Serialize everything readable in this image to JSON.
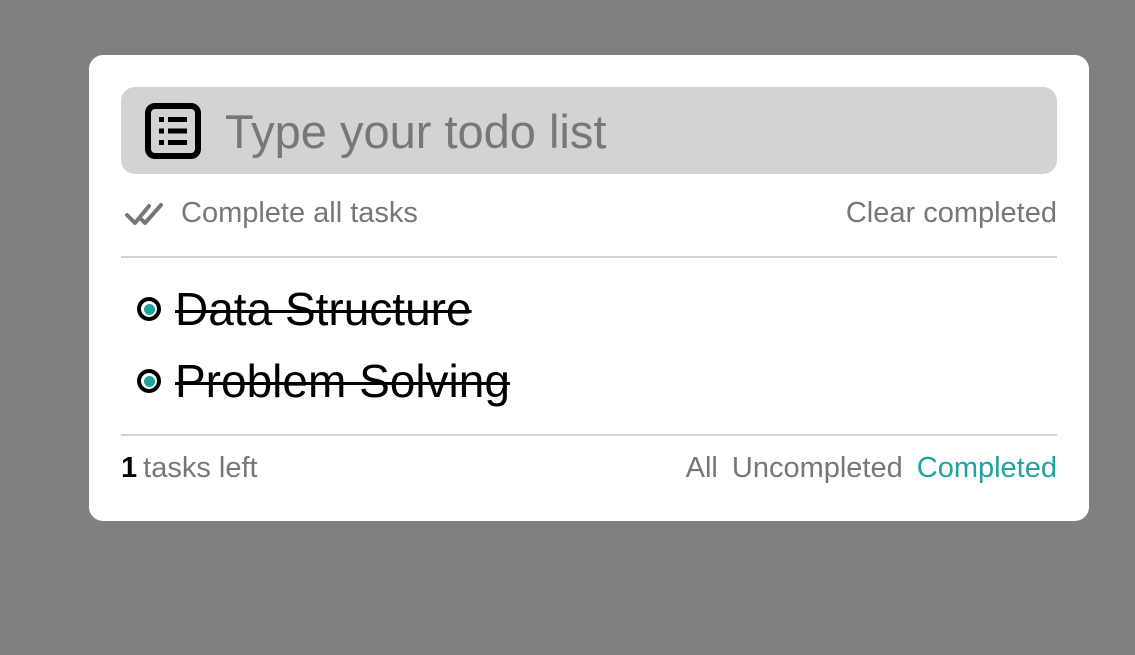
{
  "input": {
    "placeholder": "Type your todo list",
    "value": ""
  },
  "actions": {
    "complete_all_label": "Complete all tasks",
    "clear_completed_label": "Clear completed"
  },
  "tasks": [
    {
      "label": "Data Structure",
      "completed": true
    },
    {
      "label": "Problem Solving",
      "completed": true
    }
  ],
  "footer": {
    "tasks_left_count": "1",
    "tasks_left_label": "tasks left",
    "filters": [
      {
        "label": "All",
        "active": false
      },
      {
        "label": "Uncompleted",
        "active": false
      },
      {
        "label": "Completed",
        "active": true
      }
    ]
  },
  "colors": {
    "backdrop": "#808080",
    "card": "#ffffff",
    "input_bg": "#d3d3d3",
    "accent": "#20a39e",
    "muted_text": "#777777"
  },
  "icons": {
    "input": "list-icon",
    "complete_all": "double-check-icon",
    "task_status": "radio-checked-icon"
  }
}
